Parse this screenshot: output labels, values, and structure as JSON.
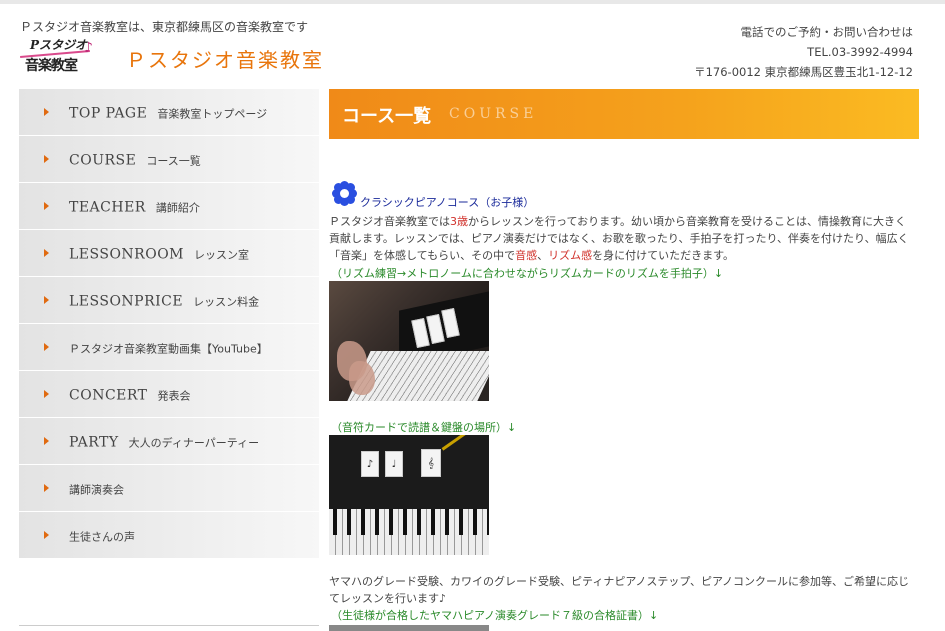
{
  "header": {
    "tagline": "Ｐスタジオ音楽教室は、東京都練馬区の音楽教室です",
    "logo_line1": "Pスタジオ",
    "logo_line2": "音楽教室",
    "site_title": "Ｐスタジオ音楽教室",
    "contact": {
      "line1": "電話でのご予約・お問い合わせは",
      "tel": "TEL.03-3992-4994",
      "address": "〒176-0012 東京都練馬区豊玉北1-12-12"
    }
  },
  "sidebar": {
    "items": [
      {
        "en": "TOP PAGE",
        "jp": "音楽教室トップページ"
      },
      {
        "en": "COURSE",
        "jp": "コース一覧"
      },
      {
        "en": "TEACHER",
        "jp": "講師紹介"
      },
      {
        "en": "LESSONROOM",
        "jp": "レッスン室"
      },
      {
        "en": "LESSONPRICE",
        "jp": "レッスン料金"
      },
      {
        "en": "",
        "jp": "Ｐスタジオ音楽教室動画集【YouTube】"
      },
      {
        "en": "CONCERT",
        "jp": "発表会"
      },
      {
        "en": "PARTY",
        "jp": "大人のディナーパーティー"
      },
      {
        "en": "",
        "jp": "講師演奏会"
      },
      {
        "en": "",
        "jp": "生徒さんの声"
      }
    ]
  },
  "main": {
    "banner_jp": "コース一覧",
    "banner_en": "COURSE",
    "course_title": "クラシックピアノコース（お子様）",
    "intro_a": "Ｐスタジオ音楽教室では",
    "intro_age": "3歳",
    "intro_b": "からレッスンを行っております。幼い頃から音楽教育を受けることは、情操教育に大きく貢献します。レッスンでは、ピアノ演奏だけではなく、お歌を歌ったり、手拍子を打ったり、伴奏を付けたり、幅広く「音楽」を体感してもらい、その中で",
    "intro_sense": "音感",
    "intro_c": "、",
    "intro_rhythm": "リズム感",
    "intro_d": "を身に付けていただきます。",
    "caption1": "（リズム練習→メトロノームに合わせながらリズムカードのリズムを手拍子）↓",
    "caption2": "（音符カードで読譜＆鍵盤の場所）↓",
    "para2": "ヤマハのグレード受験、カワイのグレード受験、ピティナピアノステップ、ピアノコンクールに参加等、ご希望に応じてレッスンを行います♪",
    "caption3": "（生徒様が合格したヤマハピアノ演奏グレード７級の合格証書）↓",
    "photo_cards": [
      "♪",
      "♩",
      "𝄞"
    ]
  },
  "colors": {
    "accent": "#e8750c",
    "banner_start": "#f08a18",
    "banner_end": "#fbbb22",
    "caption_green": "#2a8a2a",
    "highlight_red": "#d0302a"
  }
}
